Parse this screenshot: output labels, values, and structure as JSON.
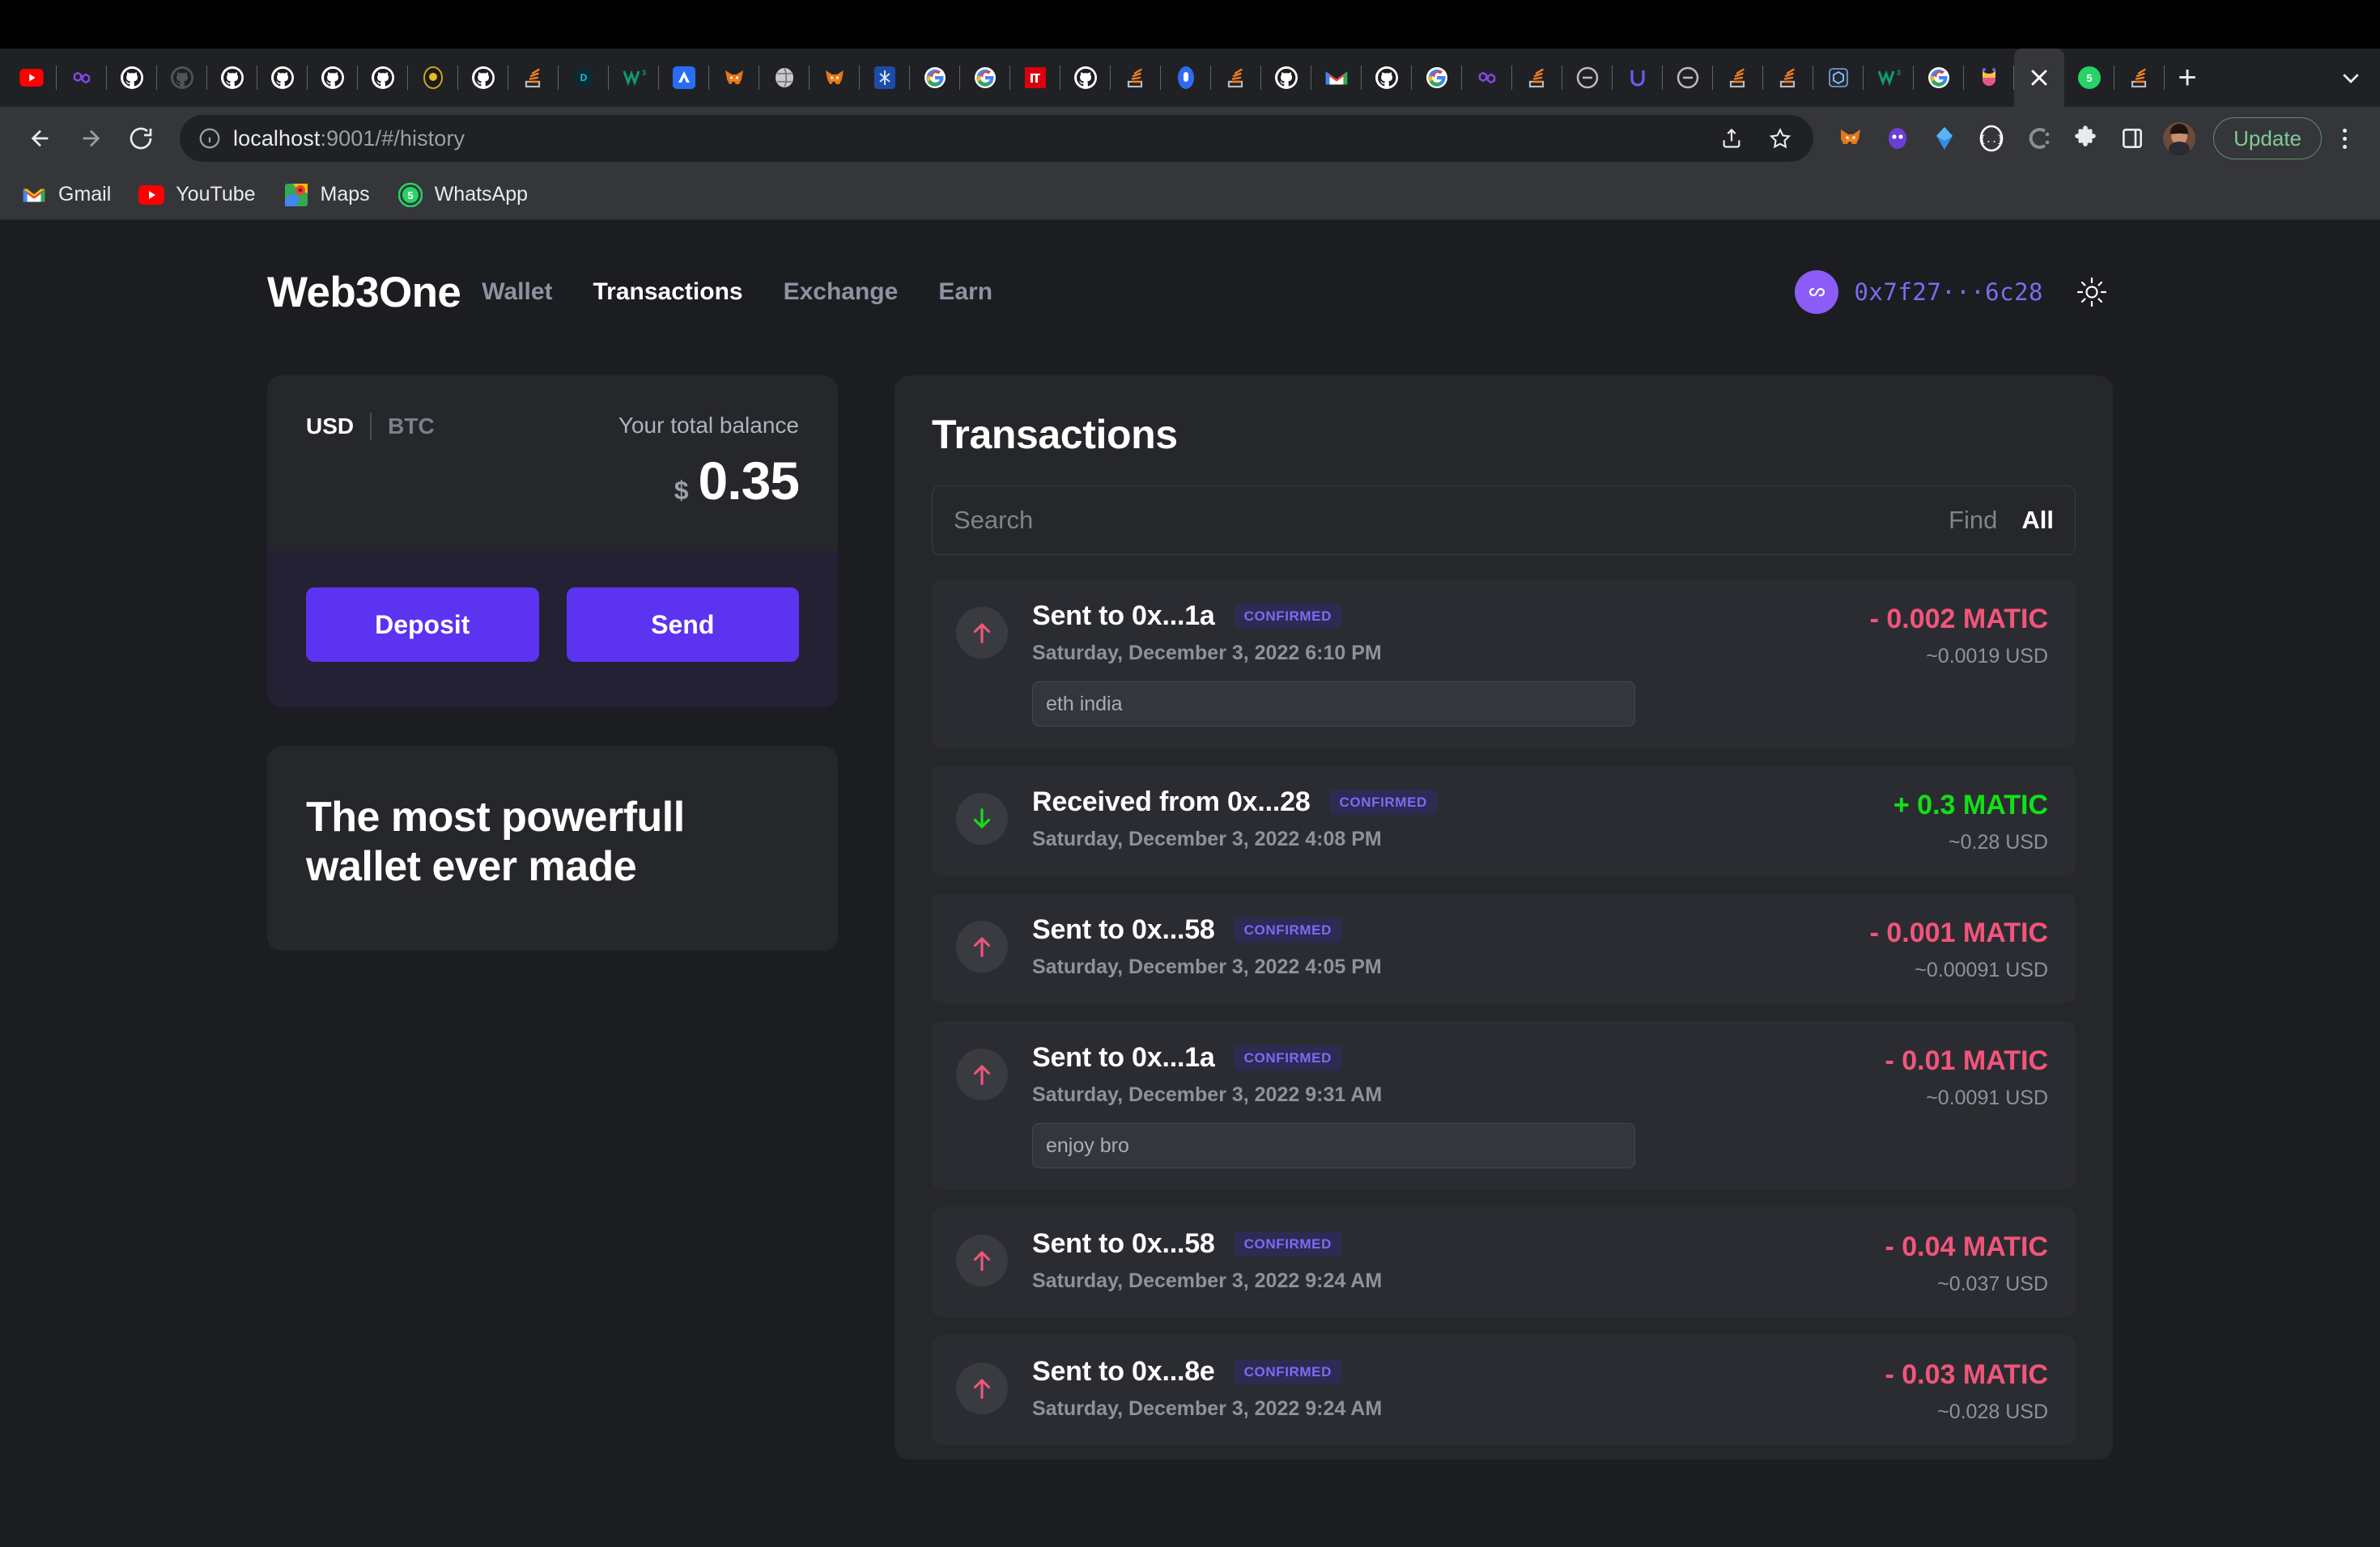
{
  "browser": {
    "url_main": "localhost",
    "url_rest": ":9001/#/history",
    "update_label": "Update",
    "tabs": [
      {
        "name": "youtube-tab",
        "icon": "youtube",
        "active": false
      },
      {
        "name": "polygon-tab",
        "icon": "polygon",
        "active": false
      },
      {
        "name": "github-tab-1",
        "icon": "github",
        "active": false
      },
      {
        "name": "github-tab-2",
        "icon": "github-dim",
        "active": false
      },
      {
        "name": "github-tab-3",
        "icon": "github",
        "active": false
      },
      {
        "name": "github-tab-4",
        "icon": "github",
        "active": false
      },
      {
        "name": "github-tab-5",
        "icon": "github",
        "active": false
      },
      {
        "name": "github-tab-6",
        "icon": "github",
        "active": false
      },
      {
        "name": "coin-tab",
        "icon": "coin",
        "active": false
      },
      {
        "name": "github-tab-7",
        "icon": "github",
        "active": false
      },
      {
        "name": "stackoverflow-tab-1",
        "icon": "stackoverflow",
        "active": false
      },
      {
        "name": "dev-tab",
        "icon": "dev",
        "active": false
      },
      {
        "name": "w3-tab",
        "icon": "w3",
        "active": false
      },
      {
        "name": "alchemy-tab",
        "icon": "alchemy",
        "active": false
      },
      {
        "name": "metamask-tab-1",
        "icon": "metamask",
        "active": false
      },
      {
        "name": "globe-tab",
        "icon": "globe",
        "active": false
      },
      {
        "name": "metamask-tab-2",
        "icon": "metamask",
        "active": false
      },
      {
        "name": "snow-tab",
        "icon": "snow",
        "active": false
      },
      {
        "name": "google-tab-1",
        "icon": "google",
        "active": false
      },
      {
        "name": "google-tab-2",
        "icon": "google",
        "active": false
      },
      {
        "name": "pi-tab",
        "icon": "pi",
        "active": false
      },
      {
        "name": "github-tab-8",
        "icon": "github",
        "active": false
      },
      {
        "name": "stackoverflow-tab-2",
        "icon": "stackoverflow",
        "active": false
      },
      {
        "name": "blue-tab",
        "icon": "blue",
        "active": false
      },
      {
        "name": "orange-tab",
        "icon": "orange",
        "active": false
      },
      {
        "name": "github-tab-9",
        "icon": "github",
        "active": false
      },
      {
        "name": "gmail-tab",
        "icon": "gmail",
        "active": false
      },
      {
        "name": "github-tab-10",
        "icon": "github",
        "active": false
      },
      {
        "name": "google-tab-3",
        "icon": "google",
        "active": false
      },
      {
        "name": "polygon-tab-2",
        "icon": "polygon",
        "active": false
      },
      {
        "name": "orange-tab-2",
        "icon": "orange",
        "active": false
      },
      {
        "name": "teal-tab",
        "icon": "teal",
        "active": false
      },
      {
        "name": "purple-u-tab",
        "icon": "purple-u",
        "active": false
      },
      {
        "name": "teal-tab-2",
        "icon": "teal",
        "active": false
      },
      {
        "name": "stackoverflow-tab-3",
        "icon": "stackoverflow",
        "active": false
      },
      {
        "name": "stackoverflow-tab-4",
        "icon": "stackoverflow",
        "active": false
      },
      {
        "name": "cube-tab",
        "icon": "cube",
        "active": false
      },
      {
        "name": "w3-tab-2",
        "icon": "w3",
        "active": false
      },
      {
        "name": "google-tab-4",
        "icon": "google",
        "active": false
      },
      {
        "name": "colorful-tab",
        "icon": "colorful",
        "active": false
      },
      {
        "name": "active-tab",
        "icon": "close",
        "active": true
      },
      {
        "name": "whatsapp-tab",
        "icon": "whatsapp",
        "active": false
      },
      {
        "name": "stackoverflow-tab-5",
        "icon": "stackoverflow",
        "active": false
      }
    ],
    "bookmarks": [
      {
        "label": "Gmail",
        "icon": "gmail-icon"
      },
      {
        "label": "YouTube",
        "icon": "youtube-icon"
      },
      {
        "label": "Maps",
        "icon": "maps-icon"
      },
      {
        "label": "WhatsApp",
        "icon": "whatsapp-icon"
      }
    ]
  },
  "app": {
    "brand": "Web3One",
    "nav": [
      {
        "label": "Wallet",
        "active": false
      },
      {
        "label": "Transactions",
        "active": true
      },
      {
        "label": "Exchange",
        "active": false
      },
      {
        "label": "Earn",
        "active": false
      }
    ],
    "account": {
      "address_short": "0x7f27···6c28",
      "avatar_icon": "infinity-icon",
      "theme_toggle_icon": "sun-icon"
    }
  },
  "balance_card": {
    "currency_active": "USD",
    "currency_inactive": "BTC",
    "label": "Your total balance",
    "symbol": "$",
    "amount": "0.35",
    "deposit_label": "Deposit",
    "send_label": "Send"
  },
  "promo_card": {
    "headline": "The most powerfull wallet ever made"
  },
  "transactions_panel": {
    "title": "Transactions",
    "search_placeholder": "Search",
    "search_value": "",
    "filter_find": "Find",
    "filter_all": "All",
    "rows": [
      {
        "direction": "sent",
        "icon": "arrow-up-icon",
        "title": "Sent to 0x...1a",
        "status": "CONFIRMED",
        "date": "Saturday, December 3, 2022 6:10 PM",
        "note": "eth india",
        "amount": "- 0.002 MATIC",
        "usd": "~0.0019 USD"
      },
      {
        "direction": "received",
        "icon": "arrow-down-icon",
        "title": "Received from 0x...28",
        "status": "CONFIRMED",
        "date": "Saturday, December 3, 2022 4:08 PM",
        "note": null,
        "amount": "+ 0.3 MATIC",
        "usd": "~0.28 USD"
      },
      {
        "direction": "sent",
        "icon": "arrow-up-icon",
        "title": "Sent to 0x...58",
        "status": "CONFIRMED",
        "date": "Saturday, December 3, 2022 4:05 PM",
        "note": null,
        "amount": "- 0.001 MATIC",
        "usd": "~0.00091 USD"
      },
      {
        "direction": "sent",
        "icon": "arrow-up-icon",
        "title": "Sent to 0x...1a",
        "status": "CONFIRMED",
        "date": "Saturday, December 3, 2022 9:31 AM",
        "note": "enjoy bro",
        "amount": "- 0.01 MATIC",
        "usd": "~0.0091 USD"
      },
      {
        "direction": "sent",
        "icon": "arrow-up-icon",
        "title": "Sent to 0x...58",
        "status": "CONFIRMED",
        "date": "Saturday, December 3, 2022 9:24 AM",
        "note": null,
        "amount": "- 0.04 MATIC",
        "usd": "~0.037 USD"
      },
      {
        "direction": "sent",
        "icon": "arrow-up-icon",
        "title": "Sent to 0x...8e",
        "status": "CONFIRMED",
        "date": "Saturday, December 3, 2022 9:24 AM",
        "note": null,
        "amount": "- 0.03 MATIC",
        "usd": "~0.028 USD"
      }
    ]
  },
  "colors": {
    "page_bg": "#1c1d21",
    "card_bg": "#26272b",
    "row_bg": "#2b2c31",
    "accent_purple": "#5b33f0",
    "avatar_purple": "#8B5CF6",
    "address_purple": "#7c6cf0",
    "negative": "#f2557a",
    "positive": "#12e016",
    "badge_bg": "#2e2a53",
    "badge_text": "#7d6af5",
    "muted_text": "#8d929c"
  }
}
